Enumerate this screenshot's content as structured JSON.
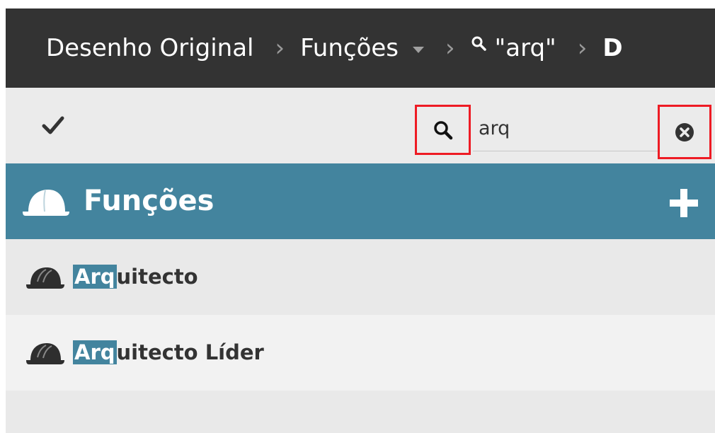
{
  "breadcrumb": {
    "items": [
      {
        "label": "Desenho Original"
      },
      {
        "label": "Funções"
      },
      {
        "label": "\"arq\""
      },
      {
        "label": "D"
      }
    ]
  },
  "toolbar": {
    "search": {
      "value": "arq",
      "placeholder": ""
    }
  },
  "section": {
    "title": "Funções"
  },
  "list": {
    "items": [
      {
        "match": "Arq",
        "rest": "uitecto"
      },
      {
        "match": "Arq",
        "rest": "uitecto Líder"
      }
    ]
  },
  "colors": {
    "breadcrumb_bg": "#333333",
    "toolbar_bg": "#ebebeb",
    "header_bg": "#43849e",
    "highlight_bg": "#43849e",
    "annotation_red": "#ee1b24",
    "row_alt_bg": "#f2f2f2"
  },
  "icons": {
    "breadcrumb_dropdown": "chevron-down-icon",
    "breadcrumb_search": "search-icon",
    "toolbar_check": "check-icon",
    "toolbar_search": "search-icon",
    "toolbar_clear": "clear-circle-icon",
    "section": "hard-hat-icon",
    "add": "plus-icon",
    "row": "hard-hat-icon"
  }
}
